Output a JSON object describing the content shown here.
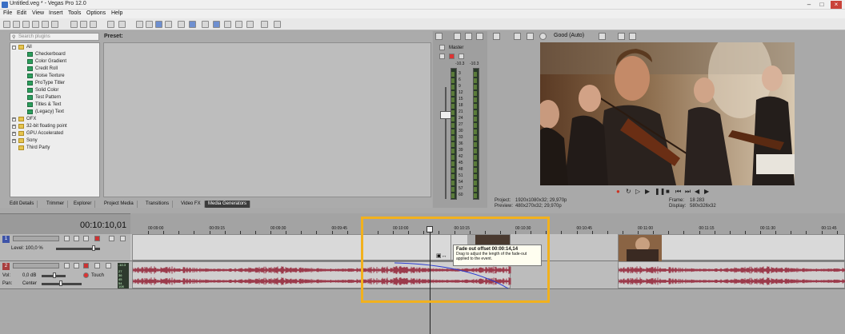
{
  "window": {
    "title": "Untitled.veg * - Vegas Pro 12.0"
  },
  "menu": [
    "File",
    "Edit",
    "View",
    "Insert",
    "Tools",
    "Options",
    "Help"
  ],
  "plugins": {
    "search_placeholder": "Search plugins",
    "preset_label": "Preset:",
    "tree": [
      {
        "label": "All",
        "level": 0,
        "kind": "folder",
        "expanded": true
      },
      {
        "label": "Checkerboard",
        "level": 1,
        "kind": "generator"
      },
      {
        "label": "Color Gradient",
        "level": 1,
        "kind": "generator"
      },
      {
        "label": "Credit Roll",
        "level": 1,
        "kind": "generator"
      },
      {
        "label": "Noise Texture",
        "level": 1,
        "kind": "generator"
      },
      {
        "label": "ProType Titler",
        "level": 1,
        "kind": "generator"
      },
      {
        "label": "Solid Color",
        "level": 1,
        "kind": "generator"
      },
      {
        "label": "Test Pattern",
        "level": 1,
        "kind": "generator"
      },
      {
        "label": "Titles & Text",
        "level": 1,
        "kind": "generator"
      },
      {
        "label": "(Legacy) Text",
        "level": 1,
        "kind": "generator"
      },
      {
        "label": "OFX",
        "level": 0,
        "kind": "folder"
      },
      {
        "label": "32-bit floating point",
        "level": 0,
        "kind": "folder"
      },
      {
        "label": "GPU Accelerated",
        "level": 0,
        "kind": "folder"
      },
      {
        "label": "Sony",
        "level": 0,
        "kind": "folder"
      },
      {
        "label": "Third Party",
        "level": 0,
        "kind": "folder"
      }
    ],
    "tabs": [
      "Edit Details",
      "Trimmer",
      "Explorer",
      "Project Media",
      "Transitions",
      "Video FX",
      "Media Generators"
    ],
    "active_tab": "Media Generators"
  },
  "master": {
    "label": "Master",
    "peak_left": "-10.3",
    "peak_right": "-10.3",
    "scale": [
      "3",
      "6",
      "9",
      "12",
      "15",
      "18",
      "21",
      "24",
      "27",
      "30",
      "33",
      "36",
      "39",
      "42",
      "45",
      "48",
      "51",
      "54",
      "57",
      "60"
    ]
  },
  "preview": {
    "quality": "Good (Auto)",
    "project_label": "Project:",
    "project_value": "1920x1080x32; 29,970p",
    "preview_label": "Preview:",
    "preview_value": "480x270x32; 29,970p",
    "frame_label": "Frame:",
    "frame_value": "18 283",
    "display_label": "Display:",
    "display_value": "580x326x32"
  },
  "timeline": {
    "timecode": "00:10:10,01",
    "ruler_labels": [
      "00:09:00",
      "00:09:15",
      "00:09:30",
      "00:09:45",
      "00:10:00",
      "00:10:15",
      "00:10:30",
      "00:10:45",
      "00:11:00",
      "00:11:15",
      "00:11:30",
      "00:11:45"
    ],
    "video_track": {
      "number": "1",
      "level_label": "Level: 100,0 %"
    },
    "audio_track": {
      "number": "2",
      "vol_label": "Vol:",
      "vol_value": "0,0 dB",
      "pan_label": "Pan:",
      "pan_value": "Center",
      "mode": "Touch",
      "meter_values": [
        "-10.3",
        "27",
        "36",
        "45",
        "54",
        "108"
      ]
    }
  },
  "tooltip": {
    "title": "Fade out offset 00:00:14,14",
    "body": "Drag to adjust the length of the fade-out applied to the event."
  },
  "colors": {
    "highlight": "#f2b11d",
    "waveform": "#9b3a4b",
    "fade_curve": "#2a3bd0",
    "active_tab": "#3c3c3c"
  }
}
